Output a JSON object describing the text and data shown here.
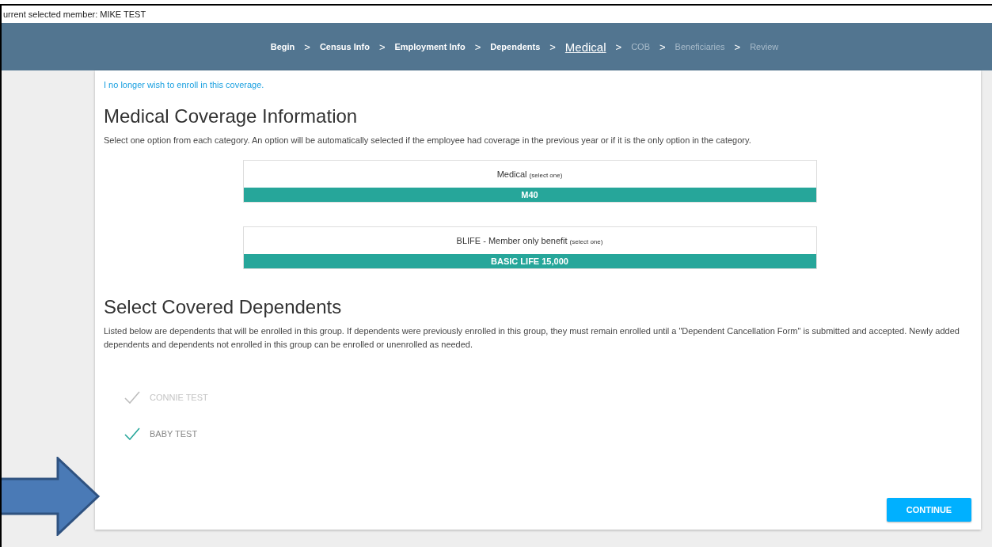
{
  "member_bar": {
    "text": "urrent selected member: MIKE TEST"
  },
  "steps": [
    {
      "label": "Begin",
      "selected": false,
      "disabled": false
    },
    {
      "label": "Census Info",
      "selected": false,
      "disabled": false
    },
    {
      "label": "Employment Info",
      "selected": false,
      "disabled": false
    },
    {
      "label": "Dependents",
      "selected": false,
      "disabled": false
    },
    {
      "label": "Medical",
      "selected": true,
      "disabled": false
    },
    {
      "label": "COB",
      "selected": false,
      "disabled": true
    },
    {
      "label": "Beneficiaries",
      "selected": false,
      "disabled": true
    },
    {
      "label": "Review",
      "selected": false,
      "disabled": true
    }
  ],
  "step_separator": ">",
  "waive_link": "I no longer wish to enroll in this coverage.",
  "coverage": {
    "title": "Medical Coverage Information",
    "description": "Select one option from each category. An option will be automatically selected if the employee had coverage in the previous year or if it is the only option in the category.",
    "plans": [
      {
        "name": "Medical",
        "hint": "(select one)",
        "choice": "M40"
      },
      {
        "name": "BLIFE - Member only benefit",
        "hint": "(select one)",
        "choice": "BASIC LIFE 15,000"
      }
    ]
  },
  "dependents": {
    "title": "Select Covered Dependents",
    "description": "Listed below are dependents that will be enrolled in this group. If dependents were previously enrolled in this group, they must remain enrolled until a \"Dependent Cancellation Form\" is submitted and accepted. Newly added dependents and dependents not enrolled in this group can be enrolled or unenrolled as needed.",
    "items": [
      {
        "name": "CONNIE TEST",
        "checked": true,
        "disabled": true
      },
      {
        "name": "BABY TEST",
        "checked": true,
        "disabled": false
      }
    ]
  },
  "continue_button": "CONTINUE"
}
